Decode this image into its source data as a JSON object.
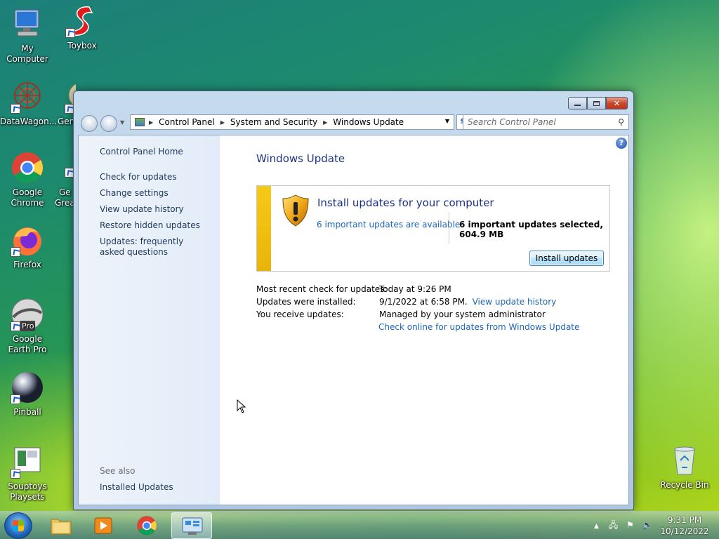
{
  "desktop": {
    "icons": [
      {
        "label": "My Computer"
      },
      {
        "label": "Toybox"
      },
      {
        "label": "DataWagon..."
      },
      {
        "label": "Gen"
      },
      {
        "label": "Google Chrome"
      },
      {
        "label": "Ge Grea"
      },
      {
        "label": "Firefox"
      },
      {
        "label": "Google Earth Pro"
      },
      {
        "label": "Pinball"
      },
      {
        "label": "Souptoys Playsets"
      },
      {
        "label": "Recycle Bin"
      }
    ],
    "earth_badge": "Pro"
  },
  "window": {
    "breadcrumb": [
      "Control Panel",
      "System and Security",
      "Windows Update"
    ],
    "search_placeholder": "Search Control Panel",
    "sidebar": {
      "home": "Control Panel Home",
      "tasks": [
        "Check for updates",
        "Change settings",
        "View update history",
        "Restore hidden updates",
        "Updates: frequently asked questions"
      ],
      "see_also": "See also",
      "installed_updates": "Installed Updates"
    },
    "title": "Windows Update",
    "panel": {
      "heading": "Install updates for your computer",
      "available_link": "6 important updates are available",
      "selected_text": "6 important updates selected, 604.9 MB",
      "install_button": "Install updates"
    },
    "info": {
      "recent_check_label": "Most recent check for updates:",
      "recent_check_value": "Today at 9:26 PM",
      "installed_label": "Updates were installed:",
      "installed_value": "9/1/2022 at 6:58 PM.",
      "history_link": "View update history",
      "receive_label": "You receive updates:",
      "receive_value": "Managed by your system administrator",
      "online_link": "Check online for updates from Windows Update"
    }
  },
  "taskbar": {
    "time": "9:31 PM",
    "date": "10/12/2022"
  },
  "colors": {
    "link": "#1c66b9",
    "title": "#1e3287",
    "panel_stripe": "#f6c918"
  }
}
